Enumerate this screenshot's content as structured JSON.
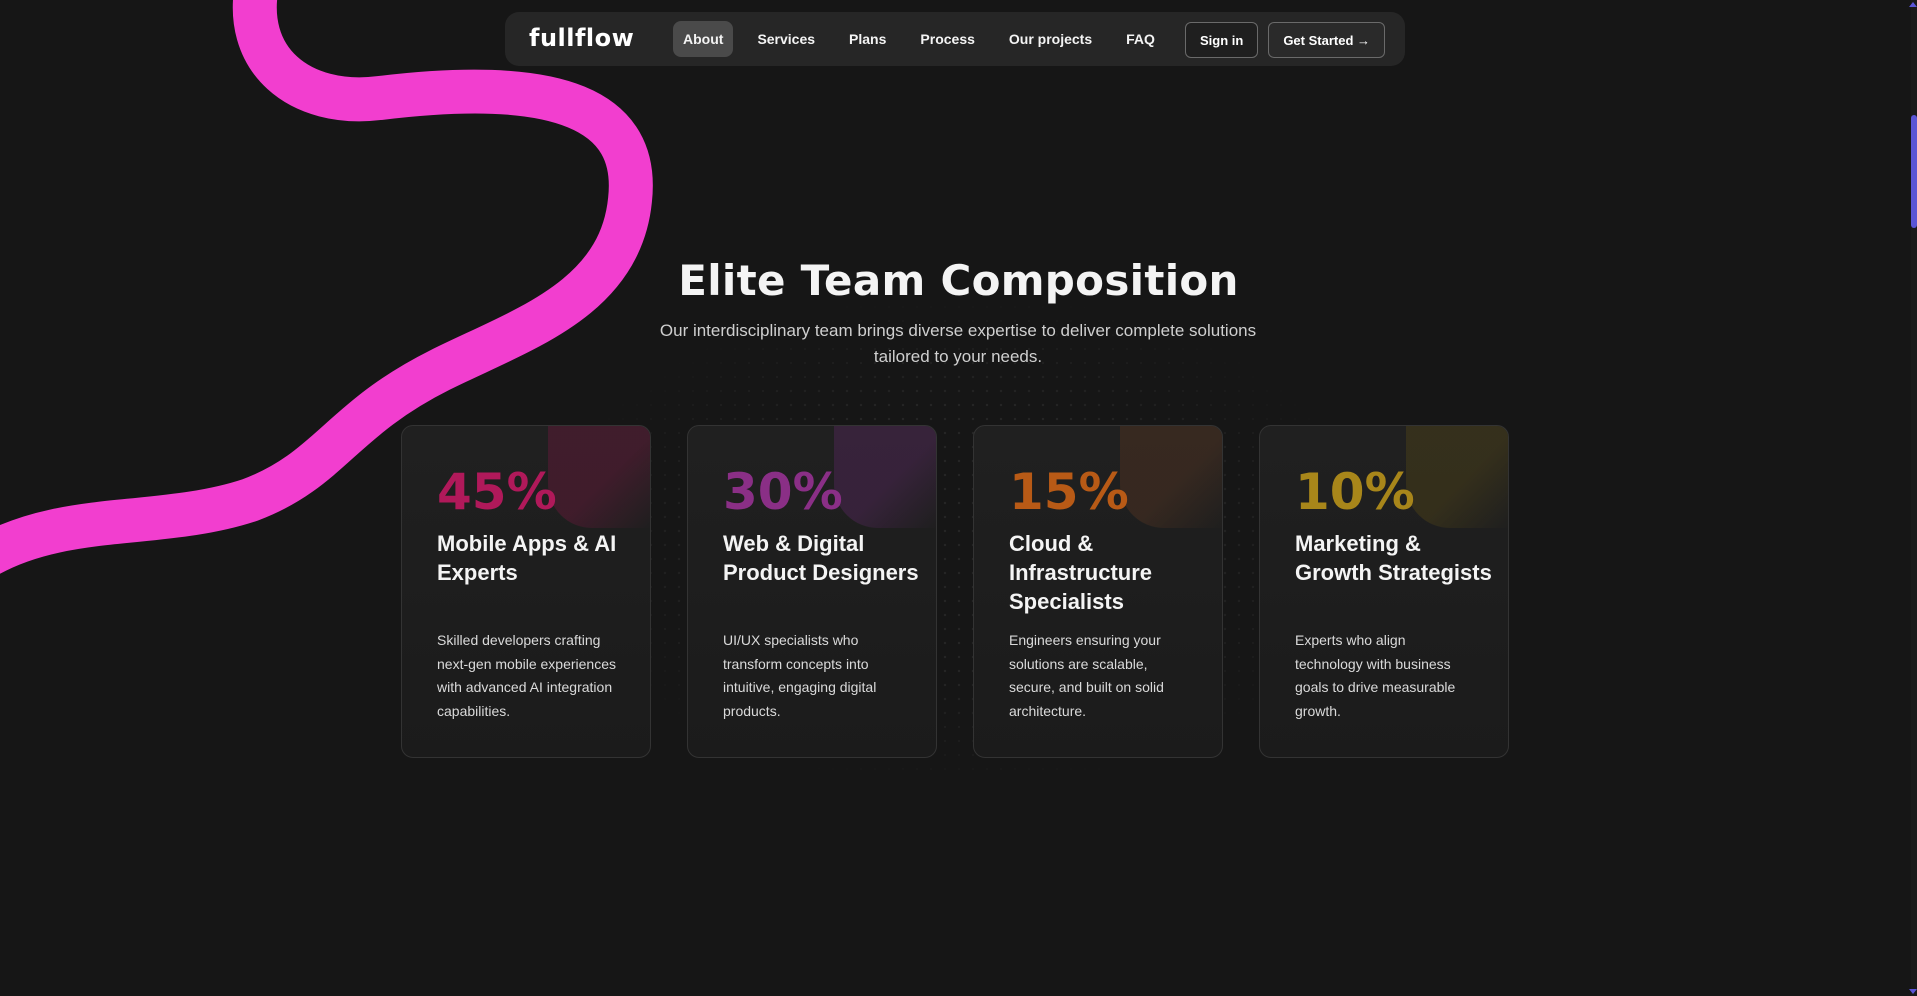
{
  "nav": {
    "logo_text": "fullflow",
    "links": [
      {
        "label": "About",
        "active": true
      },
      {
        "label": "Services",
        "active": false
      },
      {
        "label": "Plans",
        "active": false
      },
      {
        "label": "Process",
        "active": false
      },
      {
        "label": "Our  projects",
        "active": false
      },
      {
        "label": "FAQ",
        "active": false
      }
    ],
    "sign_in": "Sign in",
    "get_started": "Get Started →"
  },
  "hero": {
    "title": "Elite Team Composition",
    "subtitle": "Our interdisciplinary team brings diverse expertise to deliver complete solutions tailored to your needs."
  },
  "cards": [
    {
      "percent": "45%",
      "title": "Mobile Apps & AI Experts",
      "desc": "Skilled developers crafting next-gen mobile experiences with advanced AI integration capabilities.",
      "color": "#b0195a",
      "corner": "#5a1a35"
    },
    {
      "percent": "30%",
      "title": "Web & Digital Product Designers",
      "desc": "UI/UX specialists who transform concepts into intuitive, engaging digital products.",
      "color": "#8a2f86",
      "corner": "#4a2550"
    },
    {
      "percent": "15%",
      "title": "Cloud & Infrastructure Specialists",
      "desc": "Engineers ensuring your solutions are scalable, secure, and built on solid architecture.",
      "color": "#b85a16",
      "corner": "#4a3020"
    },
    {
      "percent": "10%",
      "title": "Marketing & Growth Strategists",
      "desc": "Experts who align technology with business goals to drive measurable growth.",
      "color": "#a8861a",
      "corner": "#463c18"
    }
  ],
  "colors": {
    "ribbon": "#f23ecf",
    "background": "#161616",
    "scrollbar": "#5b55d6"
  }
}
